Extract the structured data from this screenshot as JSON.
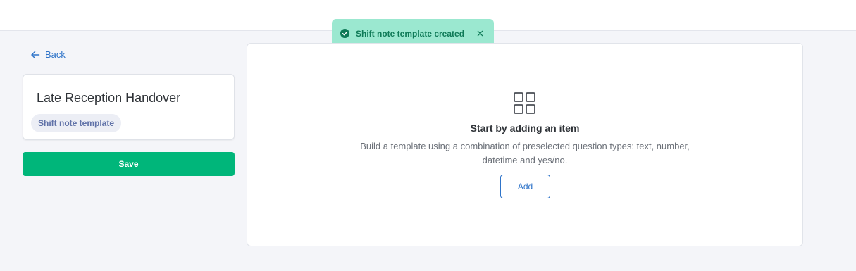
{
  "toast": {
    "message": "Shift note template created",
    "icon": "check-circle-icon",
    "close_icon": "close-icon"
  },
  "nav": {
    "back_label": "Back",
    "back_icon": "arrow-left-icon"
  },
  "template_card": {
    "title": "Late Reception Handover",
    "badge": "Shift note template"
  },
  "actions": {
    "save_label": "Save"
  },
  "empty_state": {
    "icon": "grid-icon",
    "heading": "Start by adding an item",
    "description": "Build a template using a combination of preselected question types: text, number, datetime and yes/no.",
    "add_label": "Add"
  },
  "colors": {
    "accent_blue": "#2f74c9",
    "save_green": "#00b67a",
    "toast_bg": "#9be8d0",
    "toast_text": "#0f7a57"
  }
}
